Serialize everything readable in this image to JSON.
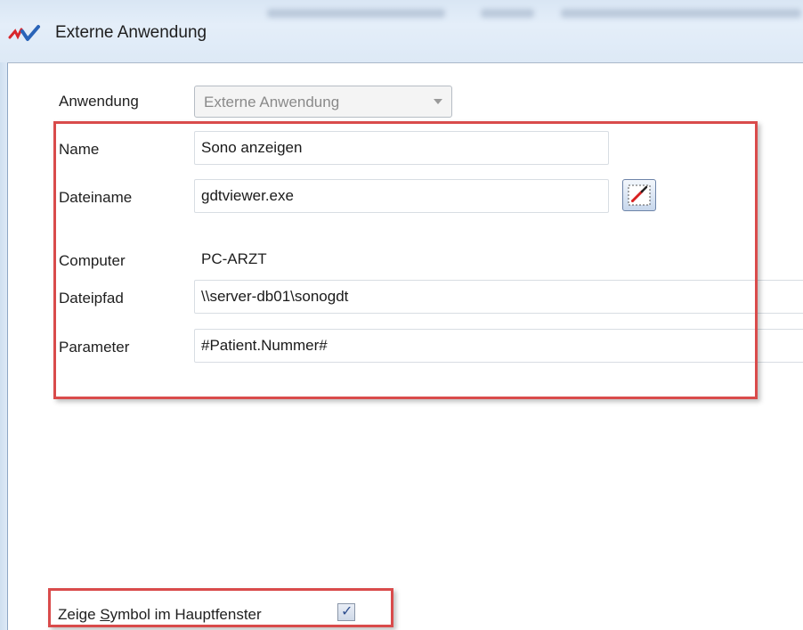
{
  "window": {
    "title": "Externe Anwendung",
    "logo_icon": "app-logo-icon"
  },
  "form": {
    "anwendung": {
      "label": "Anwendung",
      "value": "Externe Anwendung"
    },
    "name": {
      "label": "Name",
      "value": "Sono anzeigen"
    },
    "dateiname": {
      "label": "Dateiname",
      "value": "gdtviewer.exe",
      "browse_icon": "browse-file-icon"
    },
    "computer": {
      "label": "Computer",
      "value": "PC-ARZT"
    },
    "dateipfad": {
      "label": "Dateipfad",
      "value": "\\\\server-db01\\sonogdt"
    },
    "parameter": {
      "label": "Parameter",
      "value": "#Patient.Nummer#"
    }
  },
  "options": {
    "show_symbol_label_pre": "Zeige ",
    "show_symbol_label_accel": "S",
    "show_symbol_label_post": "ymbol im Hauptfenster",
    "show_symbol_checked": true
  },
  "colors": {
    "highlight": "#d94b4b",
    "titlebar": "#dde9f6"
  }
}
